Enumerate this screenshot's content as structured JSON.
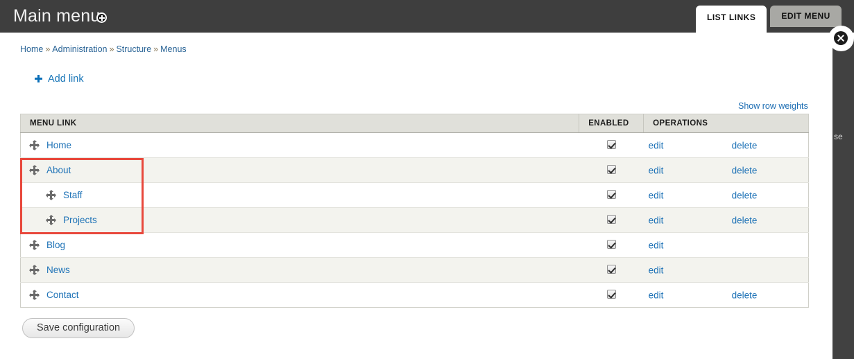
{
  "header": {
    "title": "Main menu",
    "badge_icon": "add-circle-icon",
    "tabs": [
      {
        "label": "LIST LINKS",
        "active": true
      },
      {
        "label": "EDIT MENU",
        "active": false
      }
    ],
    "close_icon": "close-circle-icon"
  },
  "overlay": {
    "side_text": "se"
  },
  "breadcrumb": {
    "separator": "»",
    "items": [
      {
        "label": "Home"
      },
      {
        "label": "Administration"
      },
      {
        "label": "Structure"
      },
      {
        "label": "Menus"
      }
    ]
  },
  "actions": {
    "add_link_label": "Add link",
    "add_link_icon": "plus-icon",
    "show_row_weights_label": "Show row weights",
    "save_label": "Save configuration"
  },
  "table": {
    "columns": [
      "MENU LINK",
      "ENABLED",
      "OPERATIONS"
    ],
    "rows": [
      {
        "label": "Home",
        "indent": false,
        "enabled": true,
        "edit": "edit",
        "delete": "delete"
      },
      {
        "label": "About",
        "indent": false,
        "enabled": true,
        "edit": "edit",
        "delete": "delete"
      },
      {
        "label": "Staff",
        "indent": true,
        "enabled": true,
        "edit": "edit",
        "delete": "delete"
      },
      {
        "label": "Projects",
        "indent": true,
        "enabled": true,
        "edit": "edit",
        "delete": "delete"
      },
      {
        "label": "Blog",
        "indent": false,
        "enabled": true,
        "edit": "edit",
        "delete": ""
      },
      {
        "label": "News",
        "indent": false,
        "enabled": true,
        "edit": "edit",
        "delete": ""
      },
      {
        "label": "Contact",
        "indent": false,
        "enabled": true,
        "edit": "edit",
        "delete": "delete"
      }
    ]
  },
  "annotation": {
    "highlight_color": "#e8483c",
    "highlight_rows": [
      "About",
      "Staff",
      "Projects"
    ]
  },
  "colors": {
    "topbar": "#3e3e3e",
    "link": "#1f73b7",
    "table_header": "#e0e0da",
    "row_even": "#f3f3ee"
  }
}
